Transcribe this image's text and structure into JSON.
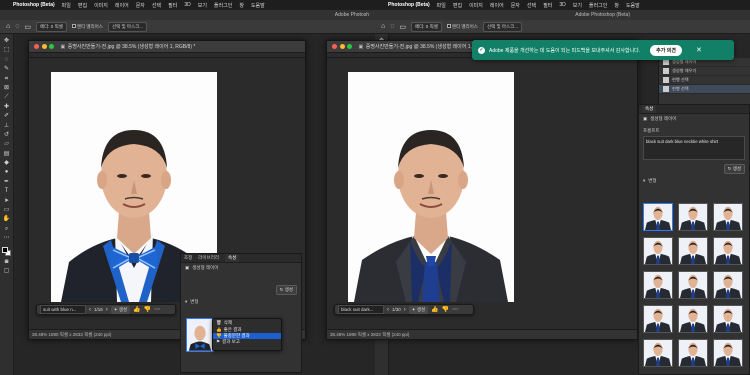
{
  "left": {
    "menubar": {
      "app": "Photoshop (Beta)",
      "items": [
        "파일",
        "편집",
        "이미지",
        "레이어",
        "문자",
        "선택",
        "필터",
        "3D",
        "보기",
        "플러그인",
        "창",
        "도움말"
      ]
    },
    "ps_title": "Adobe Photosh",
    "options": {
      "feather_label": "페더: 0 픽셀",
      "antialias": "앤티 앨리어스",
      "select_mask": "선택 및 마스크..."
    },
    "doc": {
      "title": "증명사진만들기-전.jpg @ 38.5% (생성형 레이어 1, RGB/8) *",
      "status": "38.48%   1890 픽셀 x 2833 픽셀 (240 ppi)"
    },
    "taskbar": {
      "prompt": "suit with blue n...",
      "counter": "1/16",
      "generate": "생성"
    },
    "panel": {
      "tabs": [
        "조정",
        "라이브러리",
        "속성"
      ],
      "layer_label": "생성형 레이어",
      "generate_btn": "생성",
      "variations_label": "변형"
    },
    "context_menu": {
      "items": [
        "삭제",
        "좋은 결과",
        "불충분한 결과",
        "결과 보고"
      ],
      "highlighted_index": 2
    }
  },
  "right": {
    "menubar": {
      "app": "Photoshop (Beta)",
      "items": [
        "파일",
        "편집",
        "이미지",
        "레이어",
        "문자",
        "선택",
        "필터",
        "3D",
        "보기",
        "플러그인",
        "창",
        "도움말"
      ]
    },
    "ps_title": "Adobe Photoshop (Beta)",
    "options": {
      "feather_label": "페더: 0 픽셀",
      "antialias": "앤티 앨리어스",
      "select_mask": "선택 및 마스크..."
    },
    "toast": {
      "message": "Adobe 제품을 개선하는 데 도움이 되는 피드백을 보내주셔서 감사합니다.",
      "button": "추가 의견"
    },
    "layers_mini": {
      "rows": [
        "생성형 레이어",
        "생성형 채우기",
        "현행 선택",
        "현행 선택"
      ]
    },
    "doc": {
      "title": "증명사진만들기-전.jpg @ 38.5% (생성형 레이어 1, RGB/8) *",
      "status": "38.48%   1890 픽셀 x 2833 픽셀 (240 ppi)"
    },
    "taskbar": {
      "prompt": "black suit  dark...",
      "counter": "1/30",
      "generate": "생성"
    },
    "panel": {
      "title": "속성",
      "layer_label": "생성형 레이어",
      "prompt_label": "프롬프트",
      "prompt_value": "black suit  dark blue necktie white shirt",
      "generate_btn": "생성",
      "variations_label": "변형"
    }
  },
  "colors": {
    "ps_dark": "#262626",
    "toast_green": "#128066",
    "highlight_blue": "#1b5fd1",
    "tie_blue_bright": "#1f63c9",
    "tie_navy": "#1b2f66"
  }
}
